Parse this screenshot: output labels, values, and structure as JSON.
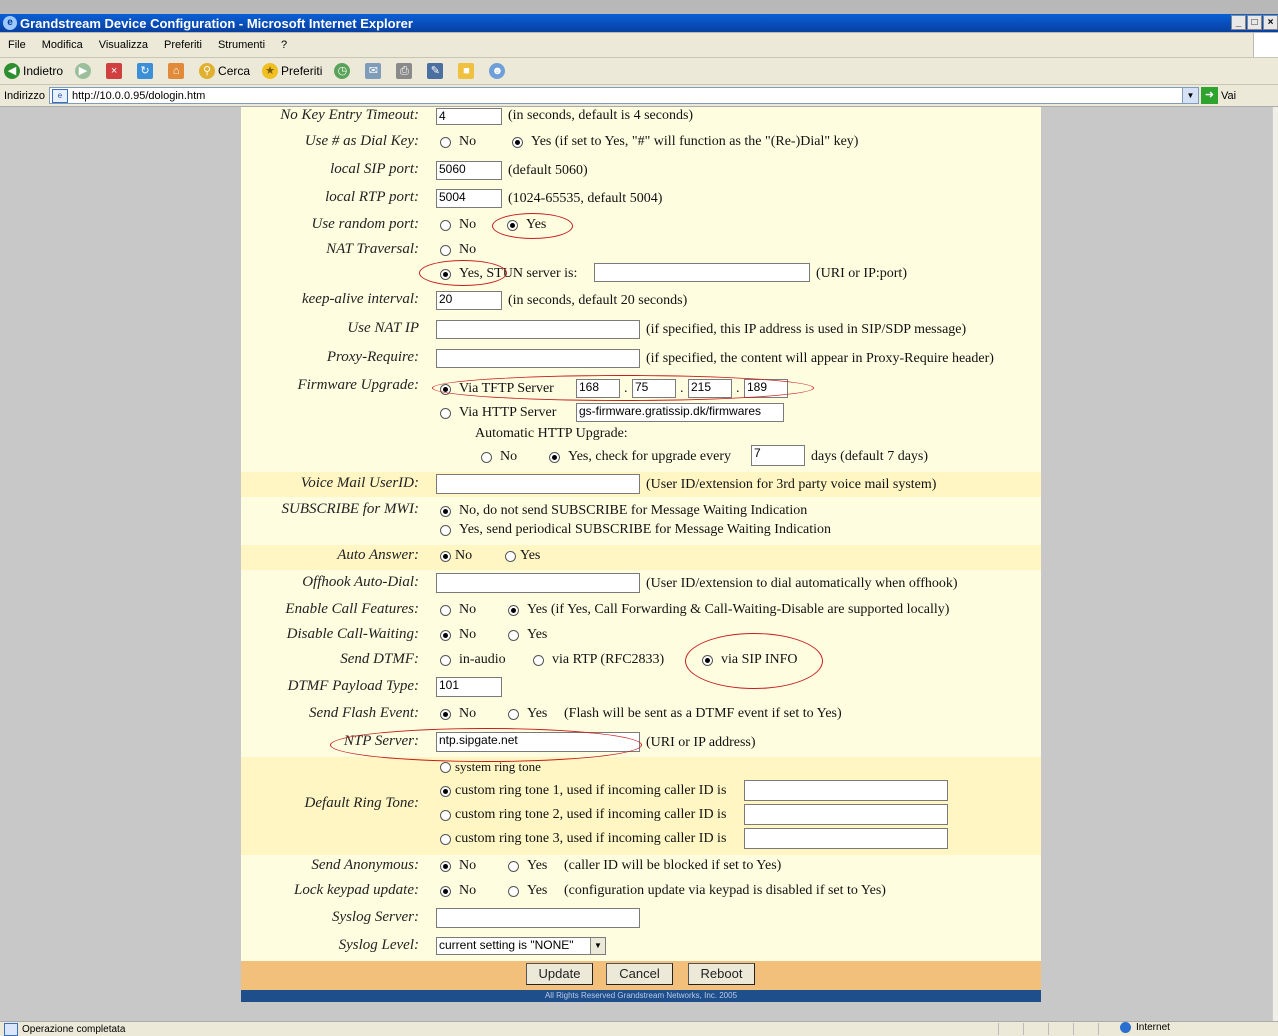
{
  "window": {
    "title": "Grandstream Device Configuration - Microsoft Internet Explorer",
    "controls": [
      "_",
      "□",
      "×"
    ]
  },
  "menu": [
    "File",
    "Modifica",
    "Visualizza",
    "Preferiti",
    "Strumenti",
    "?"
  ],
  "toolbar": {
    "back": "Indietro",
    "search": "Cerca",
    "favorites": "Preferiti"
  },
  "address": {
    "label": "Indirizzo",
    "url": "http://10.0.0.95/dologin.htm",
    "go": "Vai"
  },
  "form": {
    "no_key_timeout": {
      "label": "No Key Entry Timeout:",
      "value": "4",
      "note": "(in seconds, default is 4 seconds)"
    },
    "use_hash": {
      "label": "Use # as Dial Key:",
      "opt_no": "No",
      "opt_yes": "Yes (if set to Yes, \"#\" will function as the \"(Re-)Dial\" key)"
    },
    "local_sip_port": {
      "label": "local SIP port:",
      "value": "5060",
      "note": "(default 5060)"
    },
    "local_rtp_port": {
      "label": "local RTP port:",
      "value": "5004",
      "note": "(1024-65535, default 5004)"
    },
    "random_port": {
      "label": "Use random port:",
      "opt_no": "No",
      "opt_yes": "Yes"
    },
    "nat": {
      "label": "NAT Traversal:",
      "opt_no": "No",
      "opt_yes": "Yes, STUN server is:",
      "value": "",
      "note": "(URI or IP:port)"
    },
    "keepalive": {
      "label": "keep-alive interval:",
      "value": "20",
      "note": "(in seconds, default 20 seconds)"
    },
    "nat_ip": {
      "label": "Use NAT IP",
      "value": "",
      "note": "(if specified, this IP address is used in SIP/SDP message)"
    },
    "proxy_require": {
      "label": "Proxy-Require:",
      "value": "",
      "note": "(if specified, the content will appear in Proxy-Require header)"
    },
    "firmware": {
      "label": "Firmware Upgrade:",
      "opt_tftp": "Via TFTP Server",
      "ip": [
        "168",
        "75",
        "215",
        "189"
      ],
      "opt_http": "Via HTTP Server",
      "http_value": "gs-firmware.gratissip.dk/firmwares",
      "auto_label": "Automatic HTTP Upgrade:",
      "auto_no": "No",
      "auto_yes": "Yes, check for upgrade every",
      "days_value": "7",
      "days_note": "days (default 7 days)"
    },
    "voicemail": {
      "label": "Voice Mail UserID:",
      "value": "",
      "note": "(User ID/extension for 3rd party voice mail system)"
    },
    "subscribe_mwi": {
      "label": "SUBSCRIBE for MWI:",
      "opt_no": "No, do not send SUBSCRIBE for Message Waiting Indication",
      "opt_yes": "Yes, send periodical SUBSCRIBE for Message Waiting Indication"
    },
    "auto_answer": {
      "label": "Auto Answer:",
      "opt_no": "No",
      "opt_yes": "Yes"
    },
    "offhook_dial": {
      "label": "Offhook Auto-Dial:",
      "value": "",
      "note": "(User ID/extension to dial automatically when offhook)"
    },
    "call_features": {
      "label": "Enable Call Features:",
      "opt_no": "No",
      "opt_yes": "Yes (if Yes, Call Forwarding & Call-Waiting-Disable are supported locally)"
    },
    "disable_cw": {
      "label": "Disable Call-Waiting:",
      "opt_no": "No",
      "opt_yes": "Yes"
    },
    "send_dtmf": {
      "label": "Send DTMF:",
      "opt_audio": "in-audio",
      "opt_rtp": "via RTP (RFC2833)",
      "opt_sip": "via SIP INFO"
    },
    "dtmf_payload": {
      "label": "DTMF Payload Type:",
      "value": "101"
    },
    "flash_event": {
      "label": "Send Flash Event:",
      "opt_no": "No",
      "opt_yes": "Yes",
      "note": "(Flash will be sent as a DTMF event if set to Yes)"
    },
    "ntp": {
      "label": "NTP Server:",
      "value": "ntp.sipgate.net",
      "note": "(URI or IP address)"
    },
    "ring_tone": {
      "label": "Default Ring Tone:",
      "opt_system": "system ring tone",
      "opt_c1": "custom ring tone 1, used if incoming caller ID is",
      "opt_c2": "custom ring tone 2, used if incoming caller ID is",
      "opt_c3": "custom ring tone 3, used if incoming caller ID is"
    },
    "send_anon": {
      "label": "Send Anonymous:",
      "opt_no": "No",
      "opt_yes": "Yes",
      "note": "(caller ID will be blocked if set to Yes)"
    },
    "lock_keypad": {
      "label": "Lock keypad update:",
      "opt_no": "No",
      "opt_yes": "Yes",
      "note": "(configuration update via keypad is disabled if set to Yes)"
    },
    "syslog_server": {
      "label": "Syslog Server:",
      "value": ""
    },
    "syslog_level": {
      "label": "Syslog Level:",
      "value": "current setting is \"NONE\""
    }
  },
  "buttons": {
    "update": "Update",
    "cancel": "Cancel",
    "reboot": "Reboot"
  },
  "footer": "All Rights Reserved Grandstream Networks, Inc. 2005",
  "status": {
    "left": "Operazione completata",
    "zone": "Internet"
  },
  "colors": {
    "band_light": "#fffde0",
    "band_dark": "#fff6c4",
    "button_row": "#f2c07a",
    "annotation": "#c61d1d"
  }
}
